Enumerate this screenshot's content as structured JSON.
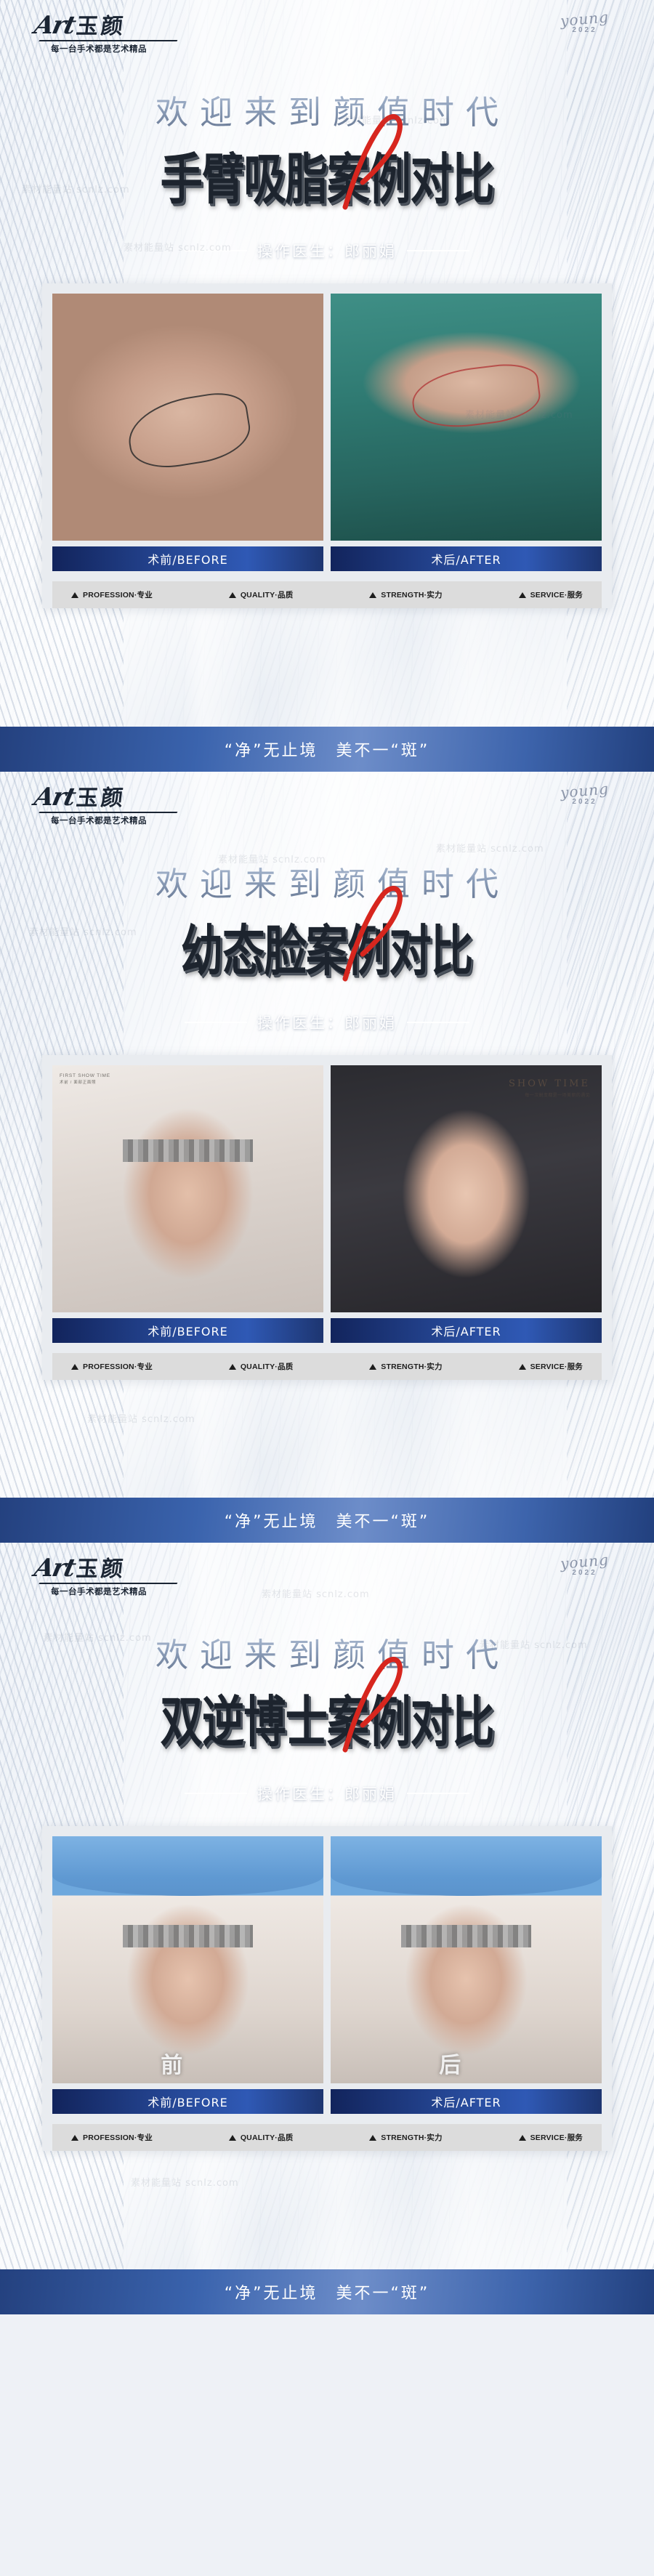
{
  "brand": {
    "script": "Art",
    "cn": "玉颜",
    "tagline": "每一台手术都是艺术精品"
  },
  "signature": {
    "word": "young",
    "year": "2022"
  },
  "labels": {
    "before": "术前/BEFORE",
    "after": "术后/AFTER"
  },
  "badges": [
    {
      "text": "PROFESSION·专业",
      "icon": "triangle-icon"
    },
    {
      "text": "QUALITY·品质",
      "icon": "triangle-icon"
    },
    {
      "text": "STRENGTH·实力",
      "icon": "triangle-icon"
    },
    {
      "text": "SERVICE·服务",
      "icon": "triangle-icon"
    }
  ],
  "footer": {
    "text": "“净”无止境　美不一“斑”"
  },
  "colors": {
    "accent_red": "#d7261e",
    "bar_blue": "#2f59b5",
    "footer_blue": "#3a63ad",
    "title_dark": "#1d242e",
    "welcome_gray": "#8ea0bb"
  },
  "panels": [
    {
      "welcome": "欢迎来到颜值时代",
      "title": "手臂吸脂案例对比",
      "doctor_label": "操作医生：郎丽娟",
      "photo_before_alt": "术前手臂标记照片",
      "photo_after_alt": "术后手臂手术照片",
      "photo_after_caption": "",
      "footer": "“净”无止境　美不一“斑”"
    },
    {
      "welcome": "欢迎来到颜值时代",
      "title": "幼态脸案例对比",
      "doctor_label": "操作医生：郎丽娟",
      "photo_before_alt": "术前面部正面照片",
      "photo_after_alt": "术后面部正面照片",
      "photo_after_caption": "SHOW TIME",
      "photo_after_subcaption": "每一次蜕变都是一场美丽的遇见",
      "photo_before_caption": "FIRST SHOW TIME",
      "photo_before_subcaption": "术前 / 面部正面照",
      "footer": "“净”无止境　美不一“斑”"
    },
    {
      "welcome": "欢迎来到颜值时代",
      "title": "双逆博士案例对比",
      "doctor_label": "操作医生：郎丽娟",
      "photo_before_alt": "术前戴手术帽正面照片",
      "photo_after_alt": "术后戴手术帽正面照片",
      "photo_before_overlay": "前",
      "photo_after_overlay": "后",
      "footer": "“净”无止境　美不一“斑”"
    }
  ],
  "watermarks": [
    "素材能量站 scnlz.com",
    "素材能量站 scnlz.com",
    "素材能量站 scnlz.com",
    "素材能量站 scnlz.com"
  ]
}
